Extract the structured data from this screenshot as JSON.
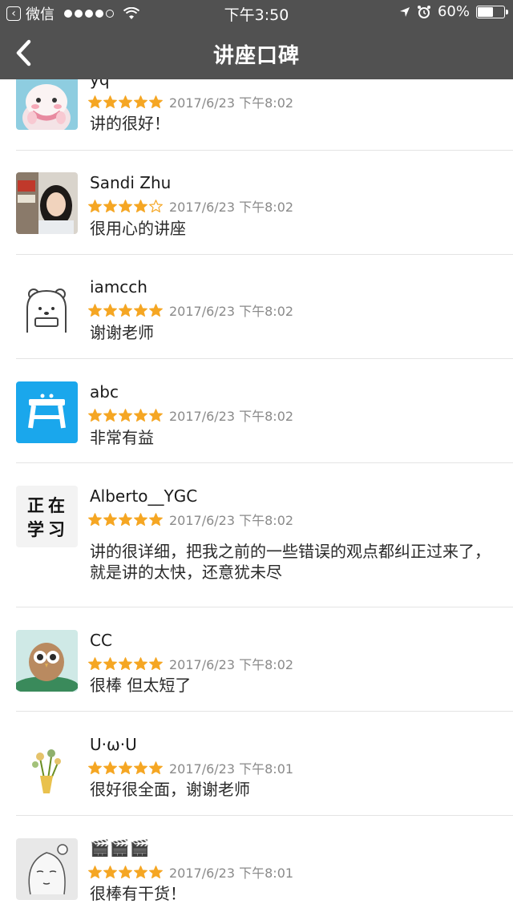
{
  "status_bar": {
    "app_name": "微信",
    "time": "下午3:50",
    "battery": "60%",
    "battery_level": 0.6
  },
  "nav": {
    "title": "讲座口碑"
  },
  "colors": {
    "header_bg": "#515151",
    "star": "#f5a623",
    "divider": "#e4e4e4"
  },
  "reviews": [
    {
      "name": "yq",
      "rating": 5,
      "time": "2017/6/23 下午8:02",
      "comment": "讲的很好！",
      "avatar_icon": "cartoon-cat-avatar"
    },
    {
      "name": "Sandi Zhu",
      "rating": 4,
      "time": "2017/6/23 下午8:02",
      "comment": "很用心的讲座",
      "avatar_icon": "photo-girl-avatar"
    },
    {
      "name": "iamcch",
      "rating": 5,
      "time": "2017/6/23 下午8:02",
      "comment": "谢谢老师",
      "avatar_icon": "cartoon-bear-avatar"
    },
    {
      "name": "abc",
      "rating": 5,
      "time": "2017/6/23 下午8:02",
      "comment": "非常有益",
      "avatar_icon": "blue-stool-avatar"
    },
    {
      "name": "Alberto__YGC",
      "rating": 5,
      "time": "2017/6/23 下午8:02",
      "comment": "讲的很详细，把我之前的一些错误的观点都纠正过来了，就是讲的太快，还意犹未尽",
      "avatar_icon": "text-avatar",
      "avatar_text": [
        "正",
        "在",
        "学",
        "习"
      ]
    },
    {
      "name": "CC",
      "rating": 5,
      "time": "2017/6/23 下午8:02",
      "comment": "很棒 但太短了",
      "avatar_icon": "owl-painting-avatar"
    },
    {
      "name": "U·ω·U",
      "rating": 5,
      "time": "2017/6/23 下午8:01",
      "comment": "很好很全面，谢谢老师",
      "avatar_icon": "flower-bouquet-avatar"
    },
    {
      "name": "🎬🎬🎬",
      "rating": 5,
      "time": "2017/6/23 下午8:01",
      "comment": "很棒有干货！",
      "avatar_icon": "sketch-girl-avatar"
    }
  ]
}
